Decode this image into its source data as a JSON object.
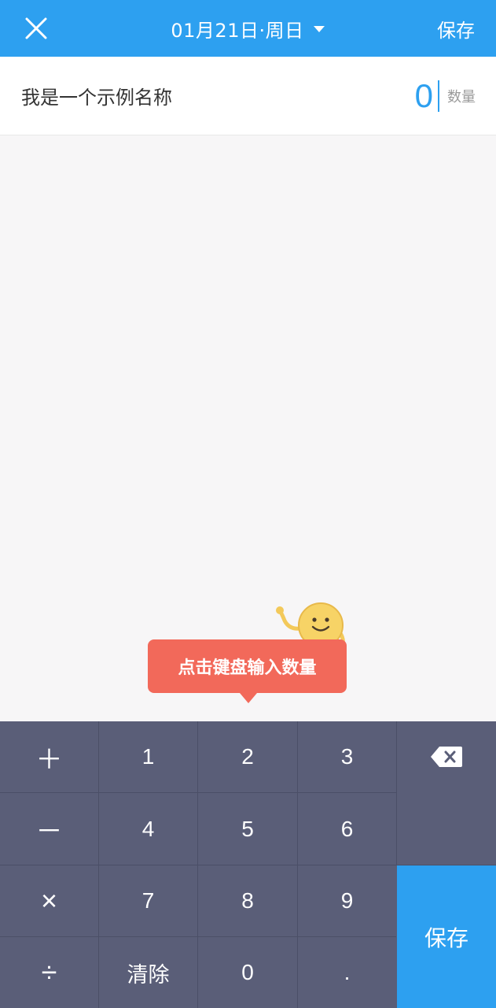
{
  "header": {
    "date": "01月21日·周日",
    "save_label": "保存"
  },
  "item": {
    "name": "我是一个示例名称",
    "quantity": "0",
    "quantity_label": "数量"
  },
  "tooltip": {
    "text": "点击键盘输入数量"
  },
  "keypad": {
    "plus": "＋",
    "minus": "－",
    "times": "×",
    "divide": "÷",
    "k1": "1",
    "k2": "2",
    "k3": "3",
    "k4": "4",
    "k5": "5",
    "k6": "6",
    "k7": "7",
    "k8": "8",
    "k9": "9",
    "clear": "清除",
    "k0": "0",
    "dot": ".",
    "backspace_icon": "backspace-icon",
    "save": "保存"
  },
  "colors": {
    "accent": "#2da0f0",
    "keypad_bg": "#5a5e78",
    "tooltip_bg": "#f2695a",
    "page_bg": "#f7f6f7"
  }
}
